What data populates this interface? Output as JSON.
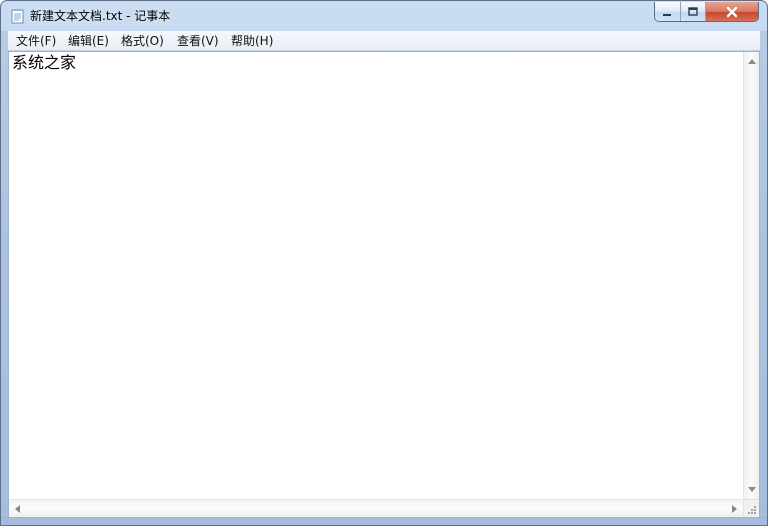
{
  "window": {
    "title": "新建文本文档.txt - 记事本",
    "icon_name": "notepad-icon"
  },
  "controls": {
    "minimize_icon": "minimize-icon",
    "maximize_icon": "maximize-icon",
    "close_icon": "close-icon"
  },
  "menu": {
    "items": [
      {
        "label": "文件(F)"
      },
      {
        "label": "编辑(E)"
      },
      {
        "label": "格式(O)"
      },
      {
        "label": "查看(V)"
      },
      {
        "label": "帮助(H)"
      }
    ]
  },
  "editor": {
    "content": "系统之家"
  },
  "scrollbars": {
    "vertical_up_icon": "scroll-up-arrow-icon",
    "vertical_down_icon": "scroll-down-arrow-icon",
    "horizontal_left_icon": "scroll-left-arrow-icon",
    "horizontal_right_icon": "scroll-right-arrow-icon",
    "resize_grip_icon": "resize-grip-icon"
  },
  "colors": {
    "window_frame": "#b8d0ec",
    "close_button": "#c6462f",
    "menu_bar": "#eef3f9",
    "editor_background": "#ffffff"
  }
}
